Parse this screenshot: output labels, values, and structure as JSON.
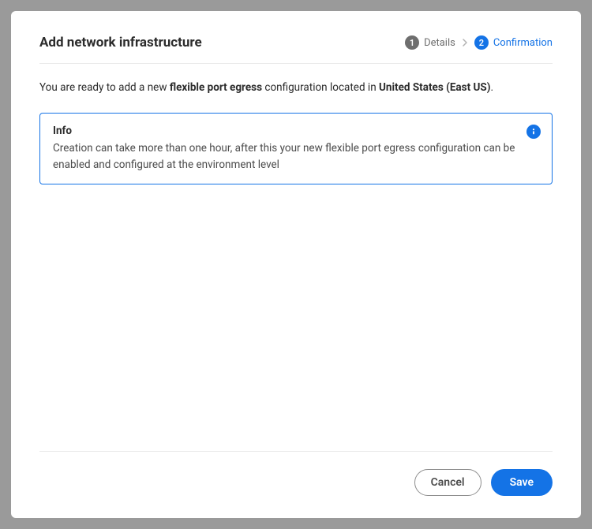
{
  "header": {
    "title": "Add network infrastructure"
  },
  "stepper": {
    "step1": {
      "number": "1",
      "label": "Details"
    },
    "step2": {
      "number": "2",
      "label": "Confirmation"
    }
  },
  "summary": {
    "prefix": "You are ready to add a new ",
    "type": "flexible port egress",
    "middle": " configuration located in ",
    "region": "United States (East US)",
    "suffix": "."
  },
  "info": {
    "title": "Info",
    "body": "Creation can take more than one hour, after this your new flexible port egress configuration can be enabled and configured at the environment level"
  },
  "footer": {
    "cancel": "Cancel",
    "save": "Save"
  }
}
